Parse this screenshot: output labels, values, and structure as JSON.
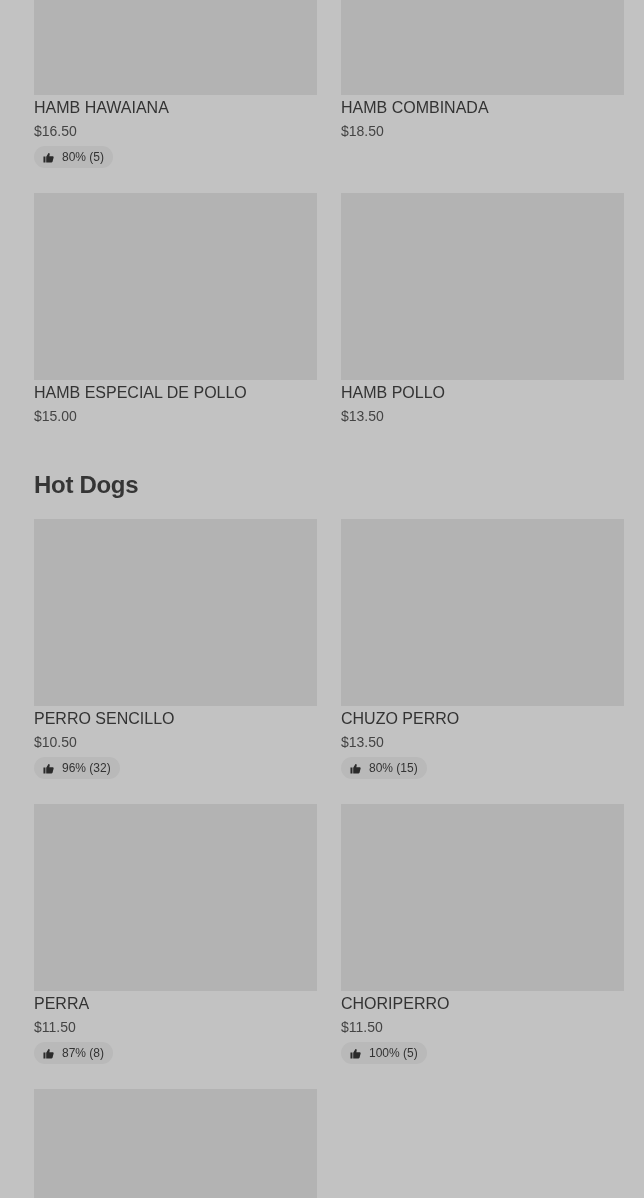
{
  "sections": [
    {
      "items": [
        {
          "name": "HAMB HAWAIANA",
          "price": "$16.50",
          "rating": "80% (5)"
        },
        {
          "name": "HAMB COMBINADA",
          "price": "$18.50"
        },
        {
          "name": "HAMB ESPECIAL DE POLLO",
          "price": "$15.00"
        },
        {
          "name": "HAMB POLLO",
          "price": "$13.50"
        }
      ]
    },
    {
      "title": "Hot Dogs",
      "items": [
        {
          "name": "PERRO SENCILLO",
          "price": "$10.50",
          "rating": "96% (32)"
        },
        {
          "name": "CHUZO PERRO",
          "price": "$13.50",
          "rating": "80% (15)"
        },
        {
          "name": "PERRA",
          "price": "$11.50",
          "rating": "87% (8)"
        },
        {
          "name": "CHORIPERRO",
          "price": "$11.50",
          "rating": "100% (5)"
        },
        {
          "image_only": true
        }
      ]
    }
  ]
}
